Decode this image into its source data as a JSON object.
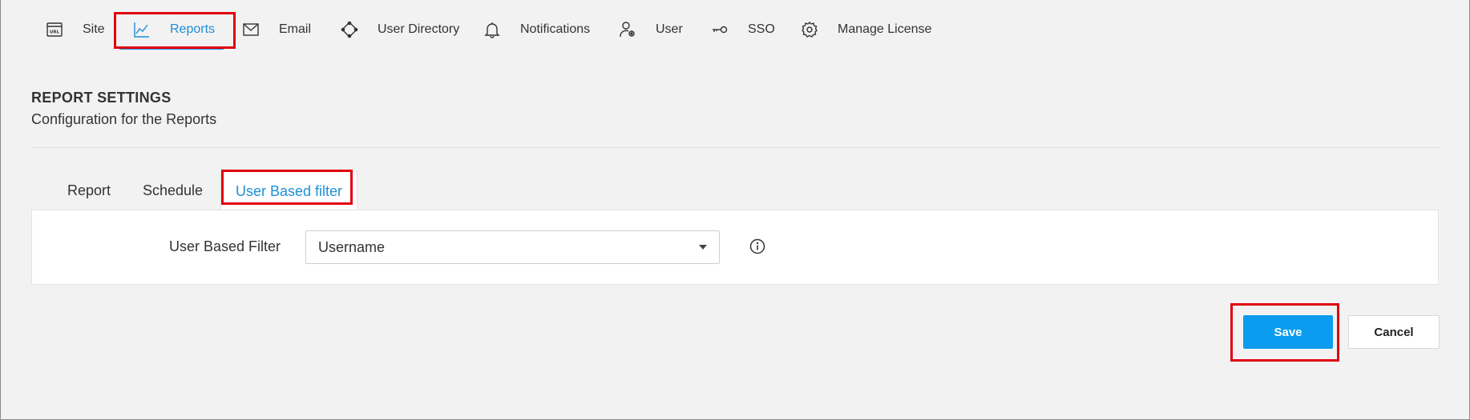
{
  "nav": {
    "items": [
      {
        "label": "Site",
        "icon": "url-icon"
      },
      {
        "label": "Reports",
        "icon": "chart-icon",
        "active": true
      },
      {
        "label": "Email",
        "icon": "envelope-icon"
      },
      {
        "label": "User Directory",
        "icon": "directory-icon"
      },
      {
        "label": "Notifications",
        "icon": "bell-icon"
      },
      {
        "label": "User",
        "icon": "user-gear-icon"
      },
      {
        "label": "SSO",
        "icon": "key-icon"
      },
      {
        "label": "Manage License",
        "icon": "gear-icon"
      }
    ]
  },
  "header": {
    "title": "REPORT SETTINGS",
    "subtitle": "Configuration for the Reports"
  },
  "tabs": [
    {
      "label": "Report"
    },
    {
      "label": "Schedule"
    },
    {
      "label": "User Based filter",
      "active": true
    }
  ],
  "form": {
    "filter_label": "User Based Filter",
    "filter_value": "Username"
  },
  "actions": {
    "save_label": "Save",
    "cancel_label": "Cancel"
  },
  "colors": {
    "accent": "#1e8fd6",
    "save_button": "#0b9cf0",
    "highlight": "#e0000f",
    "background": "#f2f2f2"
  }
}
